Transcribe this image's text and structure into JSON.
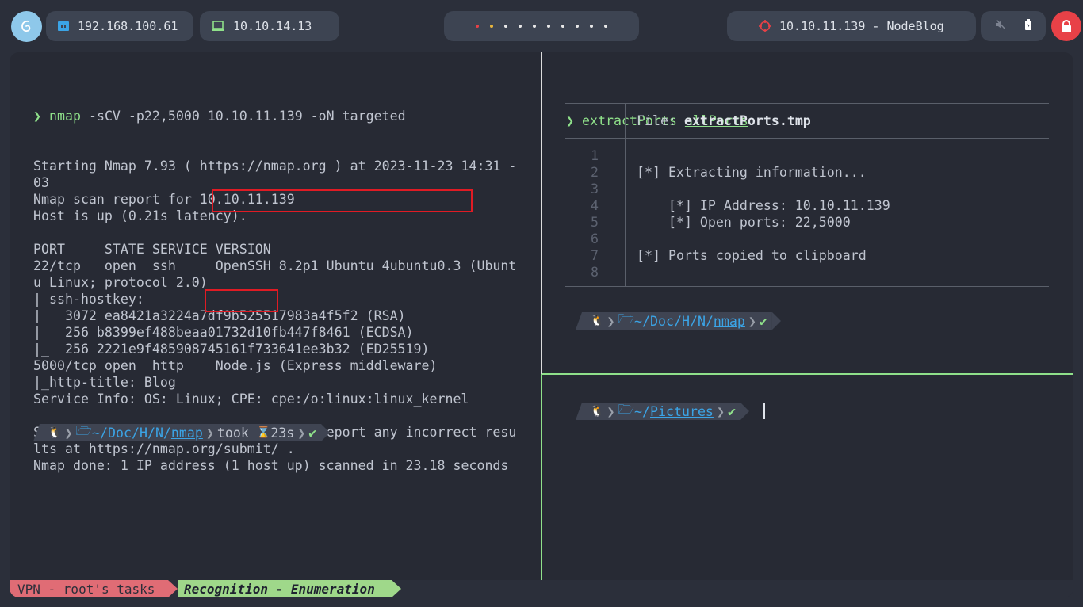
{
  "topbar": {
    "ip_ethernet": "192.168.100.61",
    "ip_vpn": "10.10.14.13",
    "target": "10.10.11.139 - NodeBlog",
    "workspace_dot_colors": [
      "#e84147",
      "#e8b53c",
      "#e8e8e8",
      "#e8e8e8",
      "#e8e8e8",
      "#e8e8e8",
      "#e8e8e8",
      "#e8e8e8",
      "#e8e8e8",
      "#e8e8e8"
    ]
  },
  "left_pane": {
    "prompt_symbol": "❯",
    "command": "nmap",
    "command_args": " -sCV -p22,5000 10.10.11.139 -oN targeted",
    "output": [
      "Starting Nmap 7.93 ( https://nmap.org ) at 2023-11-23 14:31 -",
      "03",
      "Nmap scan report for 10.10.11.139",
      "Host is up (0.21s latency).",
      "",
      "PORT     STATE SERVICE VERSION",
      "22/tcp   open  ssh     OpenSSH 8.2p1 Ubuntu 4ubuntu0.3 (Ubunt",
      "u Linux; protocol 2.0)",
      "| ssh-hostkey:",
      "|   3072 ea8421a3224a7df9b525517983a4f5f2 (RSA)",
      "|   256 b8399ef488beaa01732d10fb447f8461 (ECDSA)",
      "|_  256 2221e9f485908745161f733641ee3b32 (ED25519)",
      "5000/tcp open  http    Node.js (Express middleware)",
      "|_http-title: Blog",
      "Service Info: OS: Linux; CPE: cpe:/o:linux:linux_kernel",
      "",
      "Service detection performed. Please report any incorrect resu",
      "lts at https://nmap.org/submit/ .",
      "Nmap done: 1 IP address (1 host up) scanned in 23.18 seconds"
    ],
    "prompt": {
      "os_icon": "🐧",
      "dir_prefix": "~/Doc/H/N/",
      "dir_current": "nmap",
      "took_label": "took",
      "hourglass": "⌛",
      "took_time": "23s",
      "status": "✔"
    }
  },
  "right_top_pane": {
    "prompt_symbol": "❯",
    "command": "extractPorts",
    "command_arg": "allPorts",
    "file_label": "File:",
    "file_name": "extractPorts.tmp",
    "line_numbers": [
      "1",
      "2",
      "3",
      "4",
      "5",
      "6",
      "7",
      "8"
    ],
    "file_lines": [
      "",
      "[*] Extracting information...",
      "",
      "    [*] IP Address: 10.10.11.139",
      "    [*] Open ports: 22,5000",
      "",
      "[*] Ports copied to clipboard",
      ""
    ],
    "prompt": {
      "os_icon": "🐧",
      "dir_prefix": "~/Doc/H/N/",
      "dir_current": "nmap",
      "status": "✔"
    }
  },
  "right_bottom_pane": {
    "prompt": {
      "os_icon": "🐧",
      "dir_prefix": "~/",
      "dir_current": "Pictures",
      "status": "✔"
    }
  },
  "statusbar": {
    "session": "VPN - root's tasks",
    "window": "Recognition - Enumeration"
  }
}
